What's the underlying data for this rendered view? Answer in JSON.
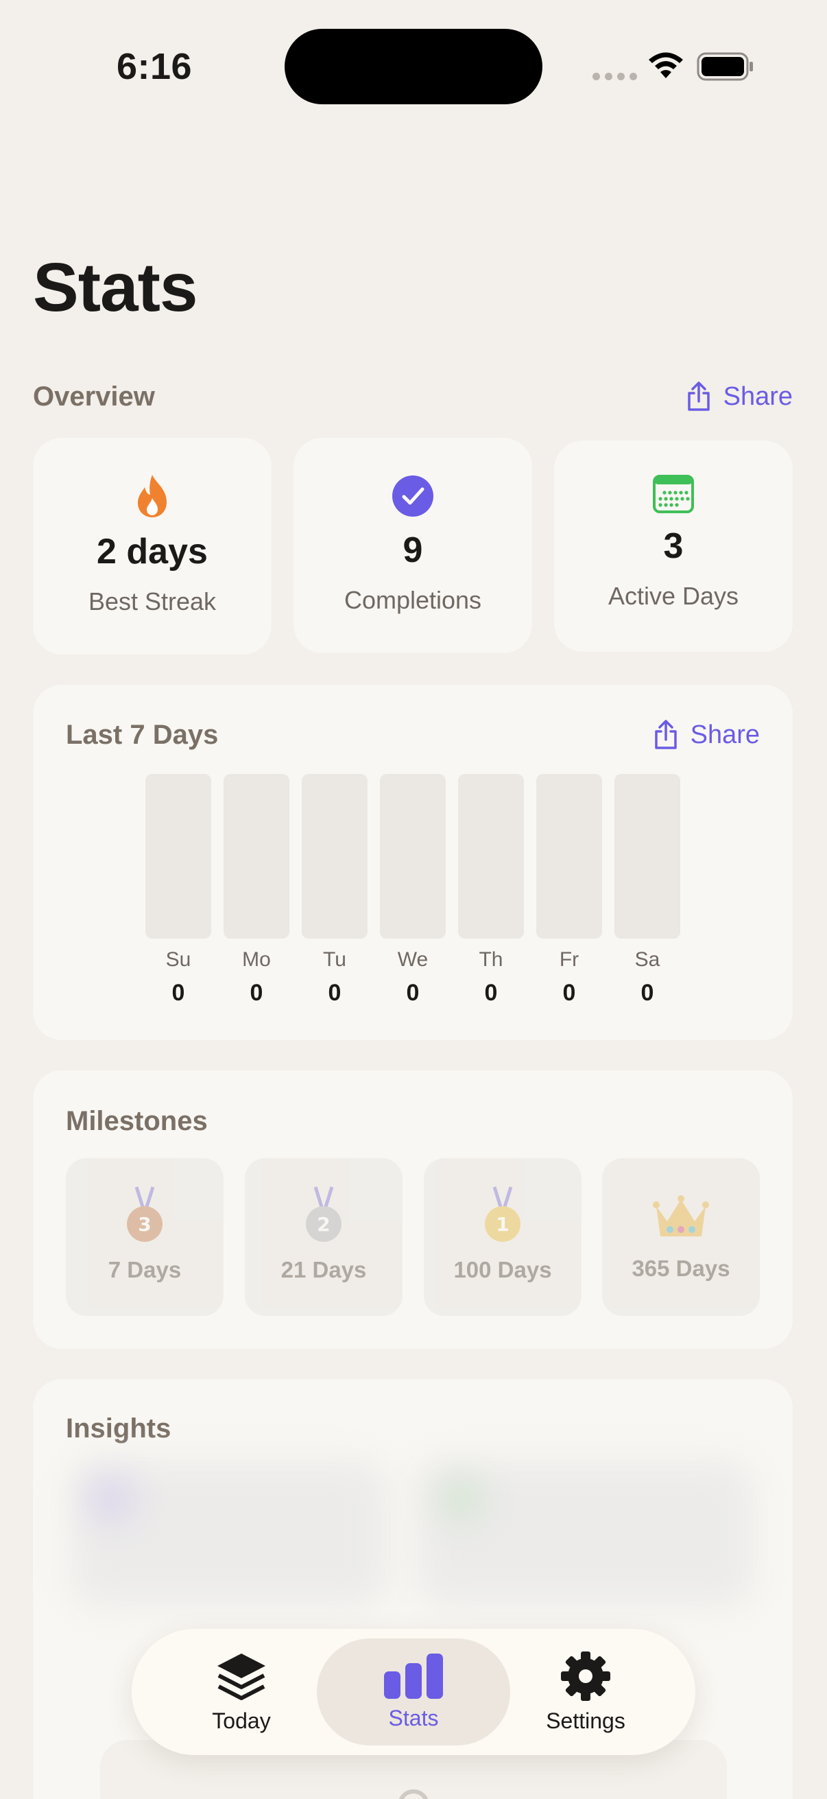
{
  "status_bar": {
    "time": "6:16"
  },
  "page": {
    "title": "Stats"
  },
  "overview": {
    "label": "Overview",
    "share_label": "Share",
    "cards": [
      {
        "icon": "flame-icon",
        "value": "2 days",
        "label": "Best Streak"
      },
      {
        "icon": "checkmark-circle-icon",
        "value": "9",
        "label": "Completions"
      },
      {
        "icon": "calendar-icon",
        "value": "3",
        "label": "Active Days"
      }
    ]
  },
  "last7": {
    "title": "Last 7 Days",
    "share_label": "Share",
    "days": [
      "Su",
      "Mo",
      "Tu",
      "We",
      "Th",
      "Fr",
      "Sa"
    ],
    "values": [
      "0",
      "0",
      "0",
      "0",
      "0",
      "0",
      "0"
    ]
  },
  "milestones": {
    "title": "Milestones",
    "items": [
      {
        "icon": "bronze-medal-icon",
        "label": "7 Days"
      },
      {
        "icon": "silver-medal-icon",
        "label": "21 Days"
      },
      {
        "icon": "gold-medal-icon",
        "label": "100 Days"
      },
      {
        "icon": "crown-icon",
        "label": "365 Days"
      }
    ]
  },
  "insights": {
    "title": "Insights"
  },
  "tabbar": {
    "active": "Stats",
    "tabs": [
      {
        "icon": "layers-icon",
        "label": "Today"
      },
      {
        "icon": "bar-chart-icon",
        "label": "Stats"
      },
      {
        "icon": "gear-icon",
        "label": "Settings"
      }
    ]
  },
  "colors": {
    "accent": "#6a5ce4",
    "flame": "#f0822f",
    "calendar": "#3fbf57",
    "background": "#f3efea",
    "card": "#f9f7f3"
  }
}
